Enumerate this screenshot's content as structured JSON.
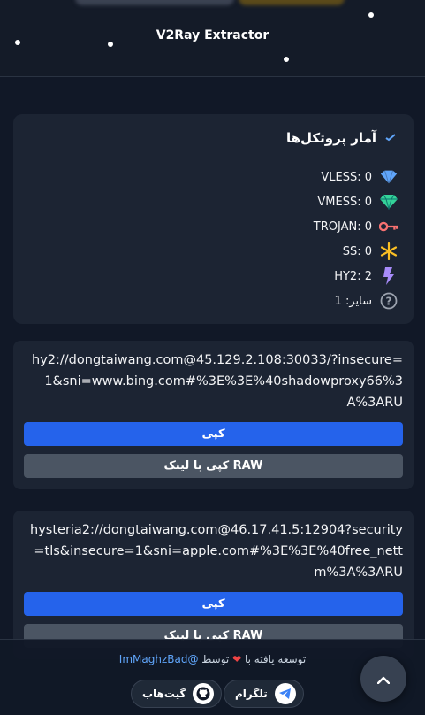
{
  "header": {
    "title": "V2Ray Extractor"
  },
  "stats": {
    "title": "آمار پروتکل‌ها",
    "rows": [
      {
        "label": "VLESS: 0",
        "icon": "wifi-icon",
        "color": "#60a5fa"
      },
      {
        "label": "VMESS: 0",
        "icon": "gem-icon",
        "color": "#34d399"
      },
      {
        "label": "TROJAN: 0",
        "icon": "key-icon",
        "color": "#f87171"
      },
      {
        "label": "SS: 0",
        "icon": "snowflake-icon",
        "color": "#fbbf24"
      },
      {
        "label": "HY2: 2",
        "icon": "bolt-icon",
        "color": "#a78bfa"
      },
      {
        "label": "سایر: 1",
        "icon": "question-circle-icon",
        "color": "#9ca3af"
      }
    ]
  },
  "configs": [
    {
      "link": "hy2://dongtaiwang.com@45.129.2.108:30033/?insecure=1&sni=www.bing.com#%3E%3E%40shadowproxy66%3A%3ARU",
      "copy_label": "کپی",
      "raw_label": "کپی با لینک RAW"
    },
    {
      "link": "hysteria2://dongtaiwang.com@46.17.41.5:12904?security=tls&insecure=1&sni=apple.com#%3E%3E%40free_nettm%3A%3ARU",
      "copy_label": "کپی",
      "raw_label": "کپی با لینک RAW"
    }
  ],
  "footer": {
    "credit_prefix": "توسعه یافته با",
    "credit_by": "توسط",
    "handle": "@ImMaghzBad",
    "telegram_label": "تلگرام",
    "github_label": "گیت‌هاب"
  },
  "colors": {
    "accent": "#2563eb",
    "background": "#111827",
    "card": "#1c2433"
  }
}
